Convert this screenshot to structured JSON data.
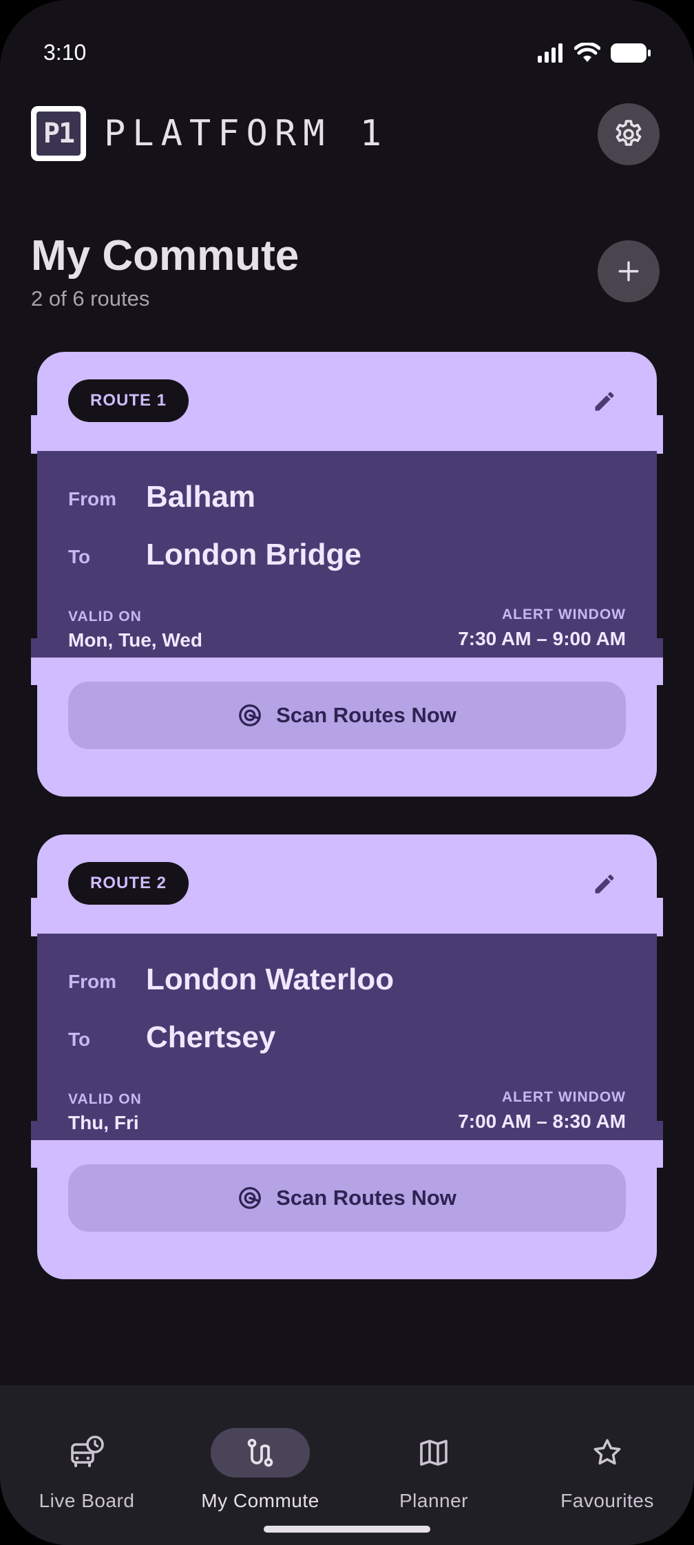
{
  "status_bar": {
    "time": "3:10"
  },
  "header": {
    "logo_text": "P1",
    "brand_name": "PLATFORM 1",
    "settings_icon": "gear-icon"
  },
  "page": {
    "title": "My Commute",
    "subtitle": "2 of 6 routes",
    "add_icon": "plus-icon"
  },
  "routes": [
    {
      "badge": "ROUTE 1",
      "from_label": "From",
      "from": "Balham",
      "to_label": "To",
      "to": "London Bridge",
      "valid_on_label": "VALID ON",
      "valid_on": "Mon, Tue, Wed",
      "alert_window_label": "ALERT WINDOW",
      "alert_window": "7:30 AM – 9:00 AM",
      "scan_label": "Scan Routes Now"
    },
    {
      "badge": "ROUTE 2",
      "from_label": "From",
      "from": "London Waterloo",
      "to_label": "To",
      "to": "Chertsey",
      "valid_on_label": "VALID ON",
      "valid_on": "Thu, Fri",
      "alert_window_label": "ALERT WINDOW",
      "alert_window": "7:00 AM – 8:30 AM",
      "scan_label": "Scan Routes Now"
    }
  ],
  "bottom_nav": {
    "items": [
      {
        "label": "Live Board",
        "icon": "bus-clock-icon",
        "active": false
      },
      {
        "label": "My Commute",
        "icon": "route-icon",
        "active": true
      },
      {
        "label": "Planner",
        "icon": "map-icon",
        "active": false
      },
      {
        "label": "Favourites",
        "icon": "star-icon",
        "active": false
      }
    ]
  },
  "colors": {
    "background": "#141218",
    "card_light": "#D0BCFF",
    "card_dark": "#4A3C73",
    "scan_button": "#B5A3E6",
    "nav_background": "#211F26",
    "active_pill": "#4A4458"
  }
}
